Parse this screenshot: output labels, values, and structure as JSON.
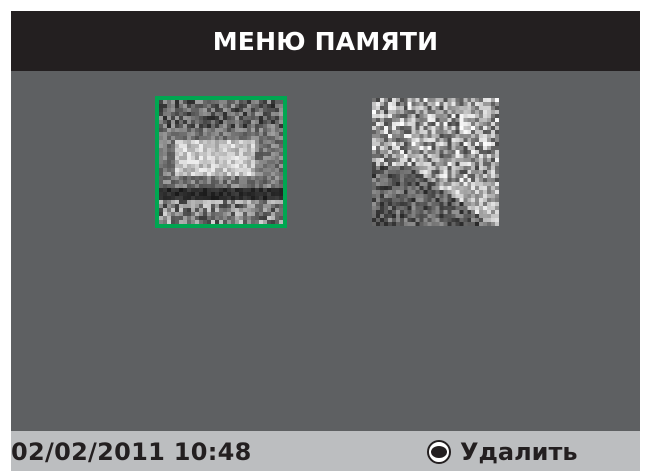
{
  "header": {
    "title": "МЕНЮ ПАМЯТИ"
  },
  "memory": {
    "items": [
      {
        "type": "photo",
        "selected": true
      },
      {
        "type": "photo",
        "selected": false
      }
    ]
  },
  "status": {
    "datetime": "02/02/2011 10:48",
    "delete_label": "Удалить",
    "delete_icon": "eye-icon"
  },
  "colors": {
    "header_bg": "#231f20",
    "content_bg": "#5e6062",
    "selection": "#00a651",
    "status_bg": "#bcbec0",
    "status_text": "#231f20"
  }
}
